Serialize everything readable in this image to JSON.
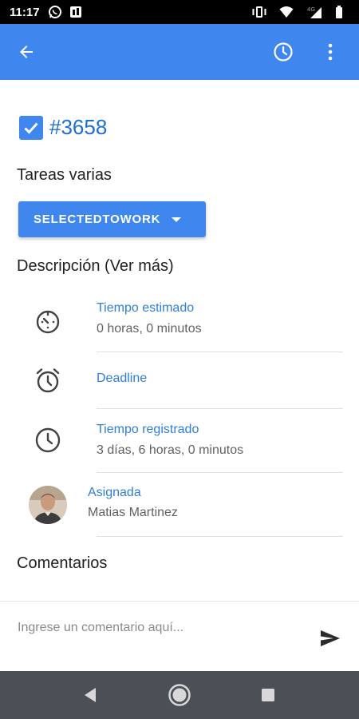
{
  "status_bar": {
    "time": "11:17",
    "network_label": "4G",
    "icons": [
      "whatsapp-icon",
      "notification-icon",
      "vibrate-icon",
      "wifi-icon",
      "signal-icon",
      "battery-icon"
    ]
  },
  "app_bar": {
    "back_icon": "arrow-left-icon",
    "history_icon": "clock-icon",
    "menu_icon": "more-vert-icon",
    "color": "#3f86ee"
  },
  "task": {
    "checked": true,
    "id": "#3658",
    "title": "Tareas varias",
    "status": "SELECTEDTOWORK"
  },
  "description_title": "Descripción (Ver más)",
  "details": {
    "estimated": {
      "label": "Tiempo estimado",
      "value": "0 horas, 0 minutos",
      "icon": "timer-icon"
    },
    "deadline": {
      "label": "Deadline",
      "value": "",
      "icon": "alarm-icon"
    },
    "logged": {
      "label": "Tiempo registrado",
      "value": "3 días, 6 horas, 0 minutos",
      "icon": "clock-icon"
    },
    "assigned": {
      "label": "Asignada",
      "value": "Matias Martinez",
      "icon": "avatar"
    }
  },
  "comments_title": "Comentarios",
  "comment_box": {
    "placeholder": "Ingrese un comentario aquí...",
    "value": "",
    "send_icon": "send-icon"
  },
  "nav_bar": {
    "icons": [
      "back-triangle-icon",
      "home-circle-icon",
      "recents-square-icon"
    ]
  },
  "colors": {
    "primary": "#3f86ee",
    "link": "#2f7fd8",
    "nav_bar": "#4b5057"
  }
}
